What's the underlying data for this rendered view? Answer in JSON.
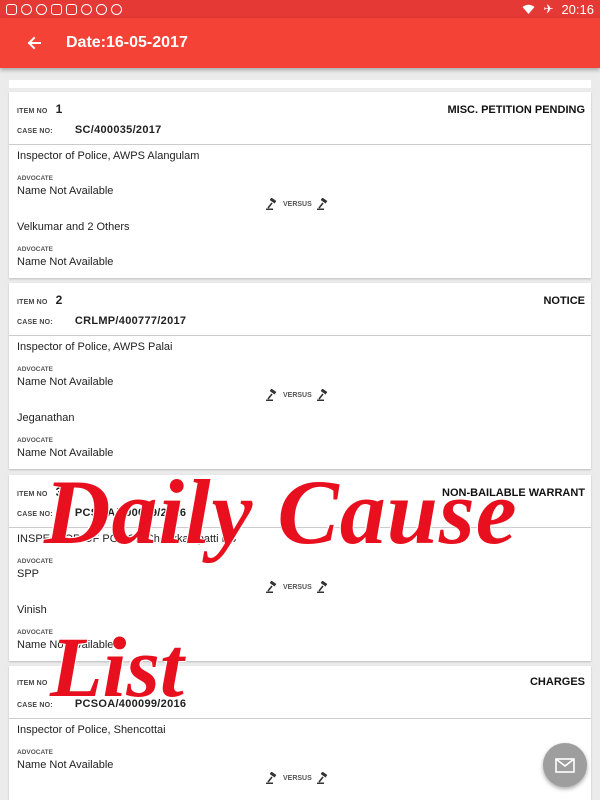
{
  "statusbar": {
    "time": "20:16"
  },
  "appbar": {
    "title": "Date:16-05-2017"
  },
  "labels": {
    "item_no": "ITEM NO",
    "case_no": "CASE NO:",
    "advocate": "ADVOCATE",
    "versus": "VERSUS"
  },
  "items": [
    {
      "item_no": "1",
      "status": "MISC. PETITION PENDING",
      "case_no": "SC/400035/2017",
      "petitioner": "Inspector of Police, AWPS Alangulam",
      "petitioner_advocate": "Name Not Available",
      "respondent": "Velkumar and 2 Others",
      "respondent_advocate": "Name Not Available"
    },
    {
      "item_no": "2",
      "status": "NOTICE",
      "case_no": "CRLMP/400777/2017",
      "petitioner": "Inspector of Police, AWPS Palai",
      "petitioner_advocate": "Name Not Available",
      "respondent": "Jeganathan",
      "respondent_advocate": "Name Not Available"
    },
    {
      "item_no": "3",
      "status": "NON-BAILABLE WARRANT",
      "case_no": "PCSOA/400099/2016",
      "petitioner": "INSPECTOR OF POLICE Chockkampatti PS",
      "petitioner_advocate": "SPP",
      "respondent": "Vinish",
      "respondent_advocate": "Name Not Available"
    },
    {
      "item_no": "",
      "status": "CHARGES",
      "case_no": "PCSOA/400099/2016",
      "petitioner": "Inspector of Police, Shencottai",
      "petitioner_advocate": "Name Not Available",
      "respondent": "",
      "respondent_advocate": ""
    }
  ],
  "watermark": {
    "line1": "Daily Cause",
    "line2": "List"
  },
  "colors": {
    "appbar": "#f44336",
    "statusbar": "#e53935",
    "watermark": "#e8101e",
    "fab": "#9e9e9e"
  },
  "icons": {
    "back": "arrow-left-icon",
    "versus": "gavel-icon",
    "fab": "mail-icon"
  }
}
